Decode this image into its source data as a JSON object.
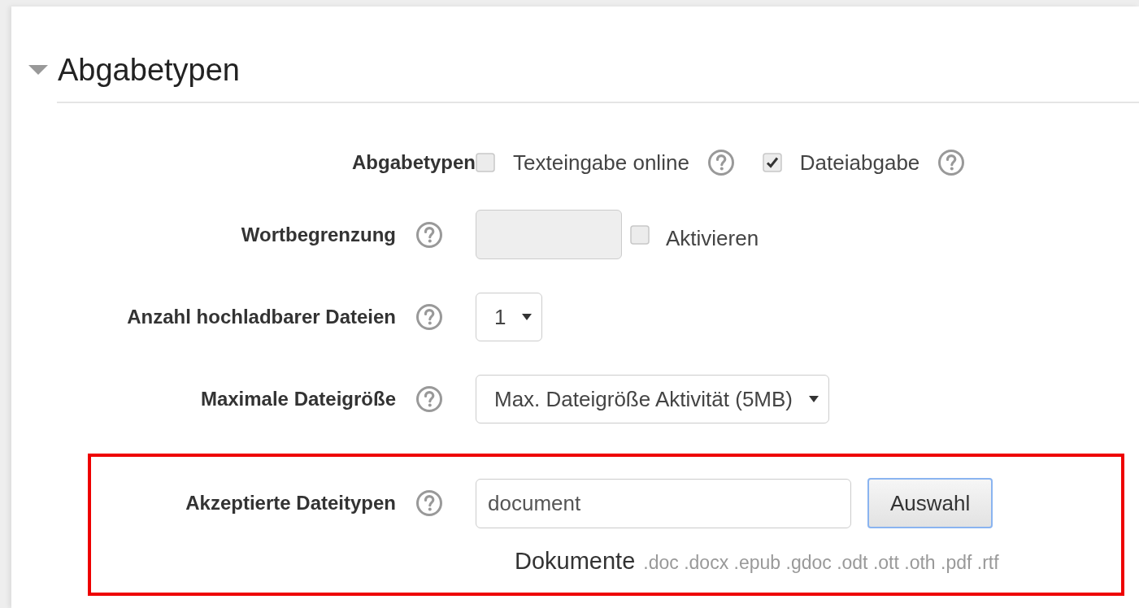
{
  "section": {
    "title": "Abgabetypen",
    "expanded": true
  },
  "fields": [
    {
      "kind": "checkboxes",
      "label": "Abgabetypen",
      "help": false,
      "options": [
        {
          "label": "Texteingabe online",
          "checked": false,
          "help": true
        },
        {
          "label": "Dateiabgabe",
          "checked": true,
          "help": true
        }
      ]
    },
    {
      "kind": "number",
      "label": "Wortbegrenzung",
      "help": true,
      "disabled": true,
      "enable": {
        "label": "Aktivieren",
        "checked": false
      }
    },
    {
      "kind": "select",
      "label": "Anzahl hochladbarer Dateien",
      "help": true,
      "value": "1"
    },
    {
      "kind": "select",
      "label": "Maximale Dateigröße",
      "help": true,
      "value": "Max. Dateigröße Aktivität (5MB)"
    },
    {
      "kind": "filetypes",
      "label": "Akzeptierte Dateitypen",
      "help": true,
      "highlighted": true,
      "value": "document",
      "button": {
        "label": "Auswahl",
        "focused": true
      },
      "group": "Dokumente",
      "extensions": ".doc .docx .epub .gdoc .odt .ott .oth .pdf .rtf"
    }
  ]
}
